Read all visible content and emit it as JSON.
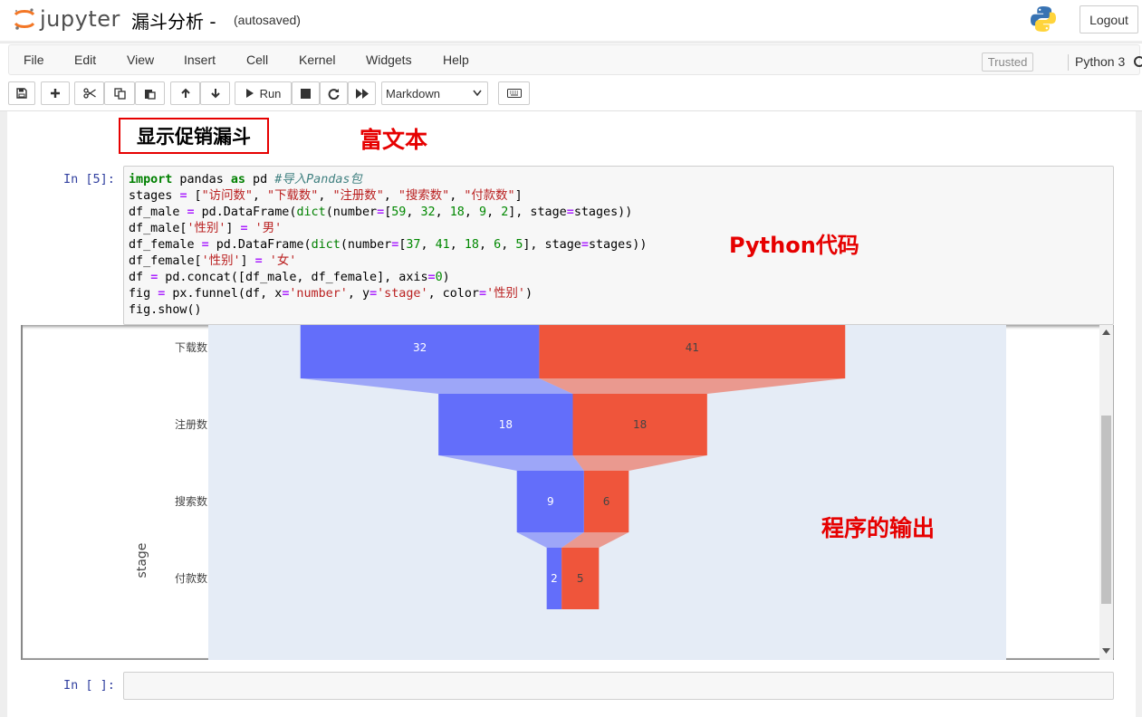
{
  "header": {
    "logo_text": "jupyter",
    "notebook_title": "漏斗分析 -",
    "autosave_status": "(autosaved)",
    "logout_label": "Logout"
  },
  "menubar": {
    "items": [
      "File",
      "Edit",
      "View",
      "Insert",
      "Cell",
      "Kernel",
      "Widgets",
      "Help"
    ],
    "trusted_label": "Trusted",
    "kernel_name": "Python 3"
  },
  "toolbar": {
    "run_label": "Run",
    "cell_type": "Markdown",
    "icons": [
      "save-icon",
      "plus-icon",
      "cut-icon",
      "copy-icon",
      "paste-icon",
      "arrow-up-icon",
      "arrow-down-icon",
      "run-icon",
      "stop-icon",
      "restart-icon",
      "fast-forward-icon",
      "keyboard-icon"
    ]
  },
  "cells": {
    "markdown_heading": "显示促销漏斗",
    "code_prompt": "In [5]:",
    "empty_prompt": "In [ ]:",
    "code_lines": [
      "import pandas as pd #导入Pandas包",
      "stages = [\"访问数\", \"下载数\", \"注册数\", \"搜索数\", \"付款数\"]",
      "df_male = pd.DataFrame(dict(number=[59, 32, 18, 9, 2], stage=stages))",
      "df_male['性别'] = '男'",
      "df_female = pd.DataFrame(dict(number=[37, 41, 18, 6, 5], stage=stages))",
      "df_female['性别'] = '女'",
      "df = pd.concat([df_male, df_female], axis=0)",
      "fig = px.funnel(df, x='number', y='stage', color='性别')",
      "fig.show()"
    ]
  },
  "annotations": {
    "rich_text": "富文本",
    "python_code": "Python代码",
    "program_output": "程序的输出"
  },
  "colors": {
    "male": "#636efa",
    "female": "#ef553b",
    "plot_bg": "#e5ecf6",
    "annotation": "#e60000"
  },
  "chart_data": {
    "type": "funnel",
    "ylabel": "stage",
    "categories": [
      "访问数",
      "下载数",
      "注册数",
      "搜索数",
      "付款数"
    ],
    "visible_categories": [
      "下载数",
      "注册数",
      "搜索数",
      "付款数"
    ],
    "series": [
      {
        "name": "男",
        "values": [
          59,
          32,
          18,
          9,
          2
        ]
      },
      {
        "name": "女",
        "values": [
          37,
          41,
          18,
          6,
          5
        ]
      }
    ]
  }
}
